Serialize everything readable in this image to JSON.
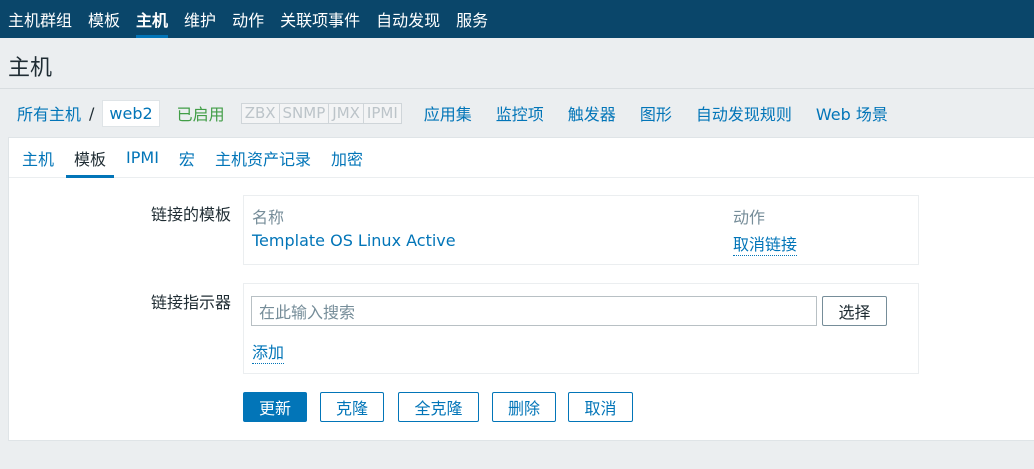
{
  "topnav": {
    "items": [
      "主机群组",
      "模板",
      "主机",
      "维护",
      "动作",
      "关联项事件",
      "自动发现",
      "服务"
    ]
  },
  "header": {
    "title": "主机"
  },
  "breadcrumb": {
    "all_hosts": "所有主机",
    "separator": "/",
    "current": "web2",
    "status": "已启用",
    "availability": [
      "ZBX",
      "SNMP",
      "JMX",
      "IPMI"
    ],
    "links": [
      "应用集",
      "监控项",
      "触发器",
      "图形",
      "自动发现规则",
      "Web 场景"
    ]
  },
  "tabs": [
    "主机",
    "模板",
    "IPMI",
    "宏",
    "主机资产记录",
    "加密"
  ],
  "linked_templates": {
    "label": "链接的模板",
    "col_name": "名称",
    "col_action": "动作",
    "rows": [
      {
        "name": "Template OS Linux Active",
        "action": "取消链接"
      }
    ]
  },
  "link_indicator": {
    "label": "链接指示器",
    "search_placeholder": "在此输入搜索",
    "select_label": "选择",
    "add_label": "添加"
  },
  "buttons": {
    "update": "更新",
    "clone": "克隆",
    "full_clone": "全克隆",
    "delete": "删除",
    "cancel": "取消"
  }
}
